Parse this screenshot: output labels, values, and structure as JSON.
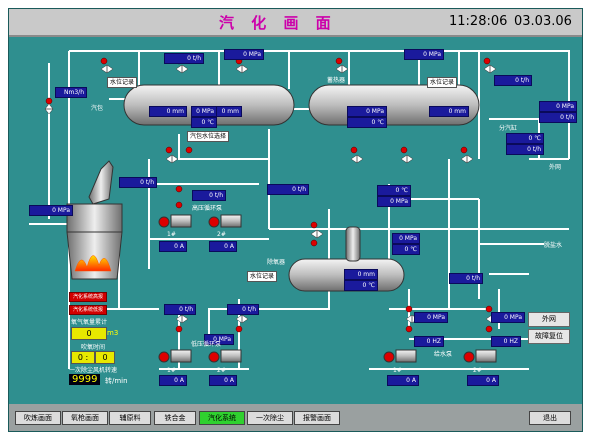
{
  "window": {
    "title": "汽 化 画 面",
    "time": "11:28:06",
    "date": "03.03.06"
  },
  "colors": {
    "background": "#2f8f8f",
    "value_box": "#1a1a9c",
    "pipe": "#ffffff",
    "alarm": "#d10000",
    "nav_active": "#2fd12f"
  },
  "tags": {
    "qibao": "汽包",
    "shuiwei_jilu_1": "水位记录",
    "shuiwei_jilu_2": "水位记录",
    "shuiwei_jilu_3": "水位记录",
    "qibao_shuiwei_xuanze": "汽包水位选择",
    "xurqi": "蓄热器",
    "fenqigang": "分汽缸",
    "waiwang": "外网",
    "gaoya_xunhuan": "高压循环泵",
    "diya_xunhuan": "低压循环泵",
    "chuyangqi": "除氧器",
    "ruanyanshui": "脱盐水",
    "geishuibeng": "给水泵",
    "pump1": "1#",
    "pump2": "2#"
  },
  "values": {
    "nm3h": "Nm3/h",
    "zero_mm": "0 mm",
    "zero_th": "0 t/h",
    "zero_mpa": "0 MPa",
    "zero_c": "0 ℃",
    "zero_a": "0 A",
    "zero_hz": "0 HZ",
    "zero_num": "0"
  },
  "alarms": {
    "a1": "汽化系统高报",
    "a2": "汽化系统低报"
  },
  "counters": {
    "yangqi_label": "氧气氧量累计",
    "yangqi_value": "0",
    "yangqi_unit": "m3",
    "chuiyang_label": "吹氧时间",
    "chuiyang_value": "0 :",
    "chuiyang_value2": "0",
    "fengji_label": "一次除尘风机转速",
    "fengji_value": "9999",
    "fengji_unit": "转/min"
  },
  "side_buttons": {
    "waiwang": "外网",
    "fuwei": "故障复位"
  },
  "nav": {
    "items": [
      "吹炼画面",
      "氧枪画面",
      "辅原料",
      "铁合金",
      "汽化系统",
      "一次除尘",
      "报警画面"
    ],
    "exit": "退出"
  }
}
